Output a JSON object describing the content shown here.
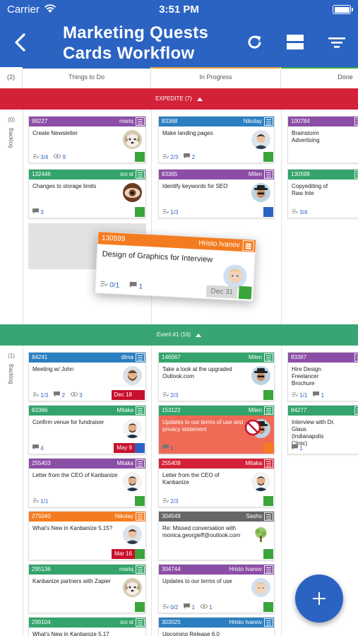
{
  "status_bar": {
    "carrier": "Carrier",
    "time": "3:51 PM"
  },
  "header": {
    "title_line1": "Marketing Quests",
    "title_line2": "Cards Workflow"
  },
  "columns": [
    {
      "count": "(2)",
      "name": "Things to Do",
      "color": "#2b63c3"
    },
    {
      "name": "In Progress",
      "color": "#f0a33a"
    },
    {
      "name": "Done",
      "color": "#3aa53c"
    }
  ],
  "lanes": [
    {
      "label": "EXPEDITE (7)",
      "color": "#d32238",
      "count": "(0)",
      "name": "Backlog"
    },
    {
      "label": "Event #1 (16)",
      "color": "#3aa574",
      "count": "(1)",
      "name": "Backlog"
    }
  ],
  "cards": [
    {
      "id": "99227",
      "owner": "mariq",
      "header_color": "#8b4ea6",
      "title": "Create Newsletter",
      "sub": "3/4",
      "com": "",
      "watch": "9",
      "due": "",
      "avatar": "dog",
      "square": "#3aa53c"
    },
    {
      "id": "132446",
      "owner": "ico st",
      "header_color": "#34a46c",
      "title": "Changes to storage limits",
      "sub": "",
      "com": "3",
      "watch": "",
      "due": "",
      "avatar": "eye",
      "square": "#3aa53c"
    },
    {
      "id": "83368",
      "owner": "Nikolay",
      "header_color": "#2b7fc1",
      "title": "Make landing pages",
      "sub": "2/3",
      "com": "2",
      "watch": "",
      "due": "",
      "avatar": "man",
      "square": "#3aa53c"
    },
    {
      "id": "83365",
      "owner": "Milen",
      "header_color": "#8b4ea6",
      "title": "Identify keywords for SEO",
      "sub": "1/3",
      "com": "",
      "watch": "",
      "due": "",
      "avatar": "hat",
      "square": "#2b63c3"
    },
    {
      "id": "100784",
      "owner": "",
      "header_color": "#8b4ea6",
      "title": "Brainstorm Advertising",
      "sub": "",
      "com": "",
      "watch": "",
      "due": "",
      "avatar": "",
      "square": ""
    },
    {
      "id": "130598",
      "owner": "",
      "header_color": "#34a46c",
      "title": "Copyediting of Raw Inte",
      "sub": "3/4",
      "com": "",
      "watch": "",
      "due": "",
      "avatar": "",
      "square": ""
    },
    {
      "id": "84241",
      "owner": "dima",
      "header_color": "#2b7fc1",
      "title": "Meeting w/ John",
      "sub": "1/3",
      "com": "2",
      "watch": "3",
      "due": "Dec 18",
      "due_color": "#c8102e",
      "avatar": "beard",
      "square": "#c8102e"
    },
    {
      "id": "83366",
      "owner": "Mitaka",
      "header_color": "#34a46c",
      "title": "Confirm venue for fundraiser",
      "sub": "",
      "com": "4",
      "watch": "",
      "due": "May 9",
      "due_color": "#c8102e",
      "avatar": "man2",
      "square": "#2b63c3"
    },
    {
      "id": "255403",
      "owner": "Mitaka",
      "header_color": "#8b4ea6",
      "title": "Letter from the CEO of Kanbanize",
      "sub": "1/1",
      "com": "",
      "watch": "",
      "due": "",
      "avatar": "man2",
      "square": "#3aa53c"
    },
    {
      "id": "275040",
      "owner": "Nikolay",
      "header_color": "#f47c20",
      "title": "What's New in Kanbanize 5.15?",
      "sub": "",
      "com": "",
      "watch": "",
      "due": "Mar 16",
      "due_color": "#c8102e",
      "avatar": "man",
      "square": "#3aa53c"
    },
    {
      "id": "295136",
      "owner": "mariq",
      "header_color": "#34a46c",
      "title": "Kanbanize partners with Zapier",
      "sub": "",
      "com": "",
      "watch": "",
      "due": "",
      "avatar": "dog",
      "square": "#3aa53c"
    },
    {
      "id": "299104",
      "owner": "ico st",
      "header_color": "#34a46c",
      "title": "What's New in Kanbanize 5.17",
      "sub": "",
      "com": "",
      "watch": "",
      "due": "",
      "avatar": "",
      "square": ""
    },
    {
      "id": "146567",
      "owner": "Milen",
      "header_color": "#34a46c",
      "title": "Take a look at the upgraded Outlook.com",
      "sub": "2/3",
      "com": "",
      "watch": "",
      "due": "",
      "avatar": "hat",
      "square": "#3aa53c"
    },
    {
      "id": "153122",
      "owner": "Milen",
      "header_color": "#34a46c",
      "title": "Updates to our terms of use and privacy statement",
      "sub": "",
      "com": "1",
      "watch": "",
      "due": "",
      "avatar": "hat",
      "square": "#f47c20"
    },
    {
      "id": "255409",
      "owner": "Mitaka",
      "header_color": "#d32238",
      "title": "Letter from the CEO of Kanbanize",
      "sub": "2/3",
      "com": "",
      "watch": "",
      "due": "",
      "avatar": "man2",
      "square": "#3aa53c"
    },
    {
      "id": "304549",
      "owner": "Sasho",
      "header_color": "#666666",
      "title": "Re: Missed conversation with monica.georgieff@outlook.com",
      "sub": "",
      "com": "",
      "watch": "",
      "due": "",
      "avatar": "tree",
      "square": "#3aa53c"
    },
    {
      "id": "304744",
      "owner": "Hristo Ivanov",
      "header_color": "#8b4ea6",
      "title": "Updates to our terms of use",
      "sub": "0/2",
      "com": "1",
      "watch": "1",
      "due": "",
      "avatar": "baby",
      "square": "#3aa53c"
    },
    {
      "id": "303025",
      "owner": "Hristo Ivanov",
      "header_color": "#2b7fc1",
      "title": "Upcoming Release 6.0",
      "sub": "",
      "com": "",
      "watch": "",
      "due": "",
      "avatar": "",
      "square": ""
    },
    {
      "id": "83367",
      "owner": "",
      "header_color": "#8b4ea6",
      "title": "Hire Design Freelancer Brochure",
      "sub": "1/1",
      "com": "1",
      "watch": "",
      "due": "",
      "avatar": "",
      "square": ""
    },
    {
      "id": "84277",
      "owner": "",
      "header_color": "#34a46c",
      "title": "Interview with Dr. Glaus (Indianapolis Clinic)",
      "sub": "",
      "com": "1",
      "watch": "",
      "due": "",
      "avatar": "",
      "square": ""
    }
  ],
  "dragging_card": {
    "id": "130599",
    "owner": "Hristo Ivanov",
    "title": "Design of Graphics for Interview",
    "sub": "0/1",
    "com": "1",
    "due": "Dec 31"
  }
}
